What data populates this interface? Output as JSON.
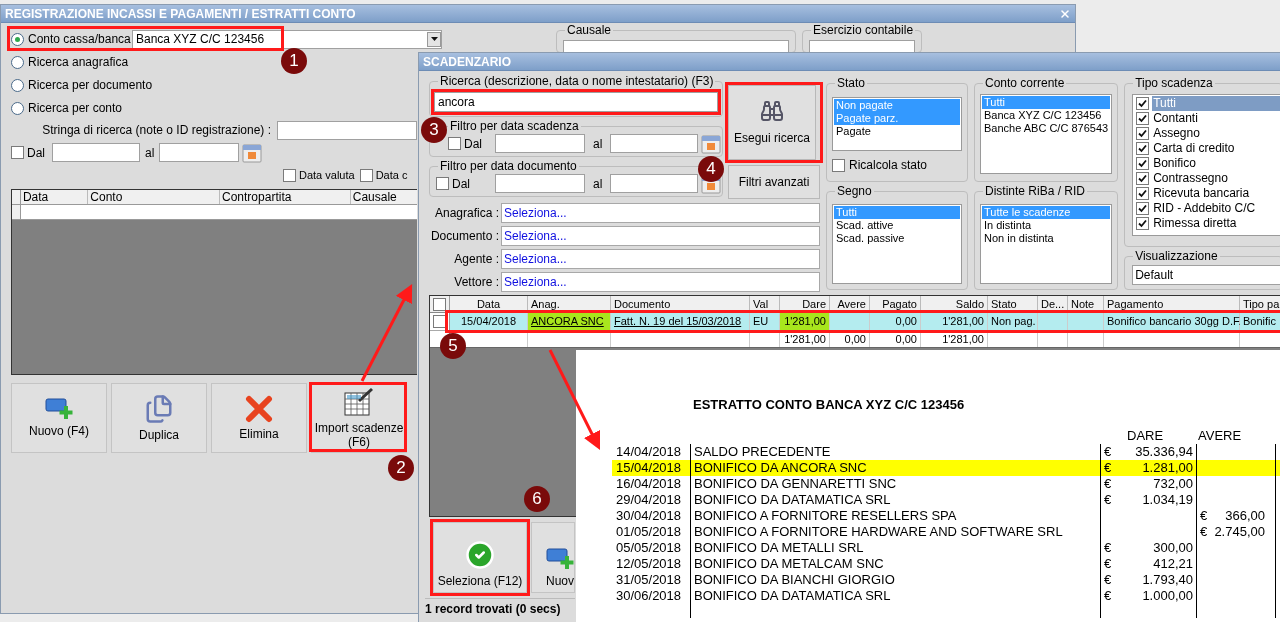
{
  "main_window": {
    "title": "REGISTRAZIONE INCASSI E PAGAMENTI / ESTRATTI CONTO",
    "search_modes": [
      {
        "label": "Conto cassa/banca",
        "selected": true
      },
      {
        "label": "Ricerca anagrafica",
        "selected": false
      },
      {
        "label": "Ricerca per documento",
        "selected": false
      },
      {
        "label": "Ricerca per conto",
        "selected": false
      }
    ],
    "account": "Banca XYZ C/C 123456",
    "group_labels": [
      "Causale",
      "Esercizio contabile"
    ],
    "search_string_label": "Stringa di ricerca (note o ID registrazione) :",
    "date_filter": {
      "checked": false,
      "from_label": "Dal",
      "to_label": "al"
    },
    "date_options": [
      {
        "label": "Data valuta",
        "checked": false
      },
      {
        "label": "Data c",
        "checked": false
      }
    ],
    "table": {
      "columns": [
        "Data",
        "Conto",
        "Contropartita",
        "Causale"
      ]
    },
    "buttons": [
      {
        "kind": "new",
        "label": "Nuovo (F4)"
      },
      {
        "kind": "duplicate",
        "label": "Duplica"
      },
      {
        "kind": "delete",
        "label": "Elimina"
      },
      {
        "kind": "import",
        "label": "Import scadenze (F6)"
      }
    ]
  },
  "scadenzario": {
    "title": "SCADENZARIO",
    "search": {
      "label": "Ricerca (descrizione, data o nome intestatario) (F3)",
      "value": "ancora"
    },
    "date_filters": [
      {
        "label": "Filtro per data scadenza",
        "checked": false,
        "from_label": "Dal",
        "to_label": "al"
      },
      {
        "label": "Filtro per data documento",
        "checked": false,
        "from_label": "Dal",
        "to_label": "al"
      }
    ],
    "search_button": "Esegui ricerca",
    "advanced_button": "Filtri avanzati",
    "lookups": [
      {
        "label": "Anagrafica :",
        "value": "Seleziona..."
      },
      {
        "label": "Documento :",
        "value": "Seleziona..."
      },
      {
        "label": "Agente :",
        "value": "Seleziona..."
      },
      {
        "label": "Vettore :",
        "value": "Seleziona..."
      }
    ],
    "lists": [
      {
        "title": "Stato",
        "items": [
          {
            "label": "Non pagate",
            "selected": true
          },
          {
            "label": "Pagate parz.",
            "selected": true
          },
          {
            "label": "Pagate",
            "selected": false
          }
        ]
      },
      {
        "title": "Conto corrente",
        "items": [
          {
            "label": "Tutti",
            "selected": true
          },
          {
            "label": "Banca XYZ C/C 123456",
            "selected": false
          },
          {
            "label": "Banche ABC C/C 876543",
            "selected": false
          }
        ]
      },
      {
        "title": "Segno",
        "items": [
          {
            "label": "Tutti",
            "selected": true
          },
          {
            "label": "Scad. attive",
            "selected": false
          },
          {
            "label": "Scad. passive",
            "selected": false
          }
        ]
      },
      {
        "title": "Distinte RiBa / RID",
        "items": [
          {
            "label": "Tutte le scadenze",
            "selected": true
          },
          {
            "label": "In distinta",
            "selected": false
          },
          {
            "label": "Non in distinta",
            "selected": false
          }
        ]
      }
    ],
    "recalc": {
      "label": "Ricalcola stato",
      "checked": false
    },
    "payment_types": {
      "title": "Tipo scadenza",
      "items": [
        {
          "label": "Tutti",
          "checked": true,
          "selected": true
        },
        {
          "label": "Contanti",
          "checked": true,
          "selected": false
        },
        {
          "label": "Assegno",
          "checked": true,
          "selected": false
        },
        {
          "label": "Carta di credito",
          "checked": true,
          "selected": false
        },
        {
          "label": "Bonifico",
          "checked": true,
          "selected": false
        },
        {
          "label": "Contrassegno",
          "checked": true,
          "selected": false
        },
        {
          "label": "Ricevuta bancaria",
          "checked": true,
          "selected": false
        },
        {
          "label": "RID - Addebito C/C",
          "checked": true,
          "selected": false
        },
        {
          "label": "Rimessa diretta",
          "checked": true,
          "selected": false
        }
      ]
    },
    "view": {
      "title": "Visualizzazione",
      "value": "Default"
    },
    "grid": {
      "all_checked": false,
      "row": {
        "checked": false,
        "selected": true
      },
      "columns": [
        {
          "label": "Data",
          "kind": "center",
          "link": false,
          "highlight": false,
          "cell": "15/04/2018"
        },
        {
          "label": "Anag.",
          "kind": "text",
          "link": true,
          "highlight": true,
          "cell": "ANCORA SNC"
        },
        {
          "label": "Documento",
          "kind": "text",
          "link": true,
          "highlight": false,
          "cell": "Fatt. N. 19 del 15/03/2018"
        },
        {
          "label": "Val",
          "kind": "text",
          "link": false,
          "highlight": false,
          "cell": "EU"
        },
        {
          "label": "Dare",
          "kind": "number",
          "link": false,
          "highlight": true,
          "cell": "1'281,00",
          "total": "1'281,00"
        },
        {
          "label": "Avere",
          "kind": "number",
          "highlight": false,
          "total": "0,00"
        },
        {
          "label": "Pagato",
          "kind": "number",
          "link": false,
          "highlight": false,
          "cell": "0,00",
          "total": "0,00"
        },
        {
          "label": "Saldo",
          "kind": "number",
          "link": false,
          "highlight": false,
          "cell": "1'281,00",
          "total": "1'281,00"
        },
        {
          "label": "Stato",
          "kind": "text",
          "link": false,
          "highlight": false,
          "cell": "Non pag."
        },
        {
          "label": "De...",
          "kind": "text",
          "highlight": false
        },
        {
          "label": "Note",
          "kind": "text",
          "highlight": false
        },
        {
          "label": "Pagamento",
          "kind": "text",
          "link": false,
          "highlight": false,
          "cell": "Bonifico bancario 30gg D.F."
        },
        {
          "label": "Tipo pa",
          "kind": "text",
          "link": false,
          "highlight": false,
          "cell": "Bonific"
        }
      ]
    },
    "buttons": [
      {
        "kind": "select",
        "label": "Seleziona (F12)"
      },
      {
        "kind": "new",
        "label": "Nuov"
      }
    ],
    "status": "1 record trovati (0 secs)"
  },
  "statement": {
    "title": "ESTRATTO CONTO BANCA XYZ C/C 123456",
    "headers": [
      "DARE",
      "AVERE"
    ],
    "rows": [
      {
        "date": "14/04/2018",
        "description": "SALDO PRECEDENTE",
        "dare_currency": "€",
        "dare": "35.336,94",
        "highlighted": false
      },
      {
        "date": "15/04/2018",
        "description": "BONIFICO DA ANCORA SNC",
        "dare_currency": "€",
        "dare": "1.281,00",
        "highlighted": true
      },
      {
        "date": "16/04/2018",
        "description": "BONIFICO DA GENNARETTI SNC",
        "dare_currency": "€",
        "dare": "732,00",
        "highlighted": false
      },
      {
        "date": "29/04/2018",
        "description": "BONIFICO DA DATAMATICA SRL",
        "dare_currency": "€",
        "dare": "1.034,19",
        "highlighted": false
      },
      {
        "date": "30/04/2018",
        "description": "BONIFICO A FORNITORE RESELLERS SPA",
        "avere_currency": "€",
        "avere": "366,00",
        "highlighted": false
      },
      {
        "date": "01/05/2018",
        "description": "BONIFICO A FORNITORE HARDWARE AND SOFTWARE SRL",
        "avere_currency": "€",
        "avere": "2.745,00",
        "highlighted": false
      },
      {
        "date": "05/05/2018",
        "description": "BONIFICO DA METALLI SRL",
        "dare_currency": "€",
        "dare": "300,00",
        "highlighted": false
      },
      {
        "date": "12/05/2018",
        "description": "BONIFICO DA METALCAM SNC",
        "dare_currency": "€",
        "dare": "412,21",
        "highlighted": false
      },
      {
        "date": "31/05/2018",
        "description": "BONIFICO DA BIANCHI GIORGIO",
        "dare_currency": "€",
        "dare": "1.793,40",
        "highlighted": false
      },
      {
        "date": "30/06/2018",
        "description": "BONIFICO DA DATAMATICA SRL",
        "dare_currency": "€",
        "dare": "1.000,00",
        "highlighted": false
      }
    ]
  },
  "annotations": {
    "markers": [
      "1",
      "2",
      "3",
      "4",
      "5",
      "6"
    ]
  }
}
